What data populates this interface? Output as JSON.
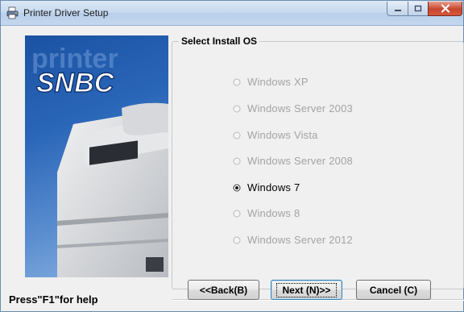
{
  "window": {
    "title": "Printer Driver Setup",
    "brand_logo": "SNBC",
    "banner_watermark": "printer",
    "colors": {
      "banner_blue": "#1b52a3",
      "close_red": "#c7452c",
      "titlebar": "#c6d9ef"
    }
  },
  "group": {
    "title": "Select Install OS",
    "options": [
      {
        "label": "Windows XP",
        "enabled": false,
        "selected": false
      },
      {
        "label": "Windows Server 2003",
        "enabled": false,
        "selected": false
      },
      {
        "label": "Windows Vista",
        "enabled": false,
        "selected": false
      },
      {
        "label": "Windows Server 2008",
        "enabled": false,
        "selected": false
      },
      {
        "label": "Windows 7",
        "enabled": true,
        "selected": true
      },
      {
        "label": "Windows 8",
        "enabled": false,
        "selected": false
      },
      {
        "label": "Windows Server 2012",
        "enabled": false,
        "selected": false
      }
    ]
  },
  "footer": {
    "help_text": "Press\"F1\"for help",
    "back_label": "<<Back(B)",
    "next_label": "Next (N)>>",
    "cancel_label": "Cancel (C)"
  },
  "icons": {
    "app": "printer-setup-icon",
    "minimize": "minimize-icon",
    "maximize": "maximize-icon",
    "close": "close-icon"
  }
}
